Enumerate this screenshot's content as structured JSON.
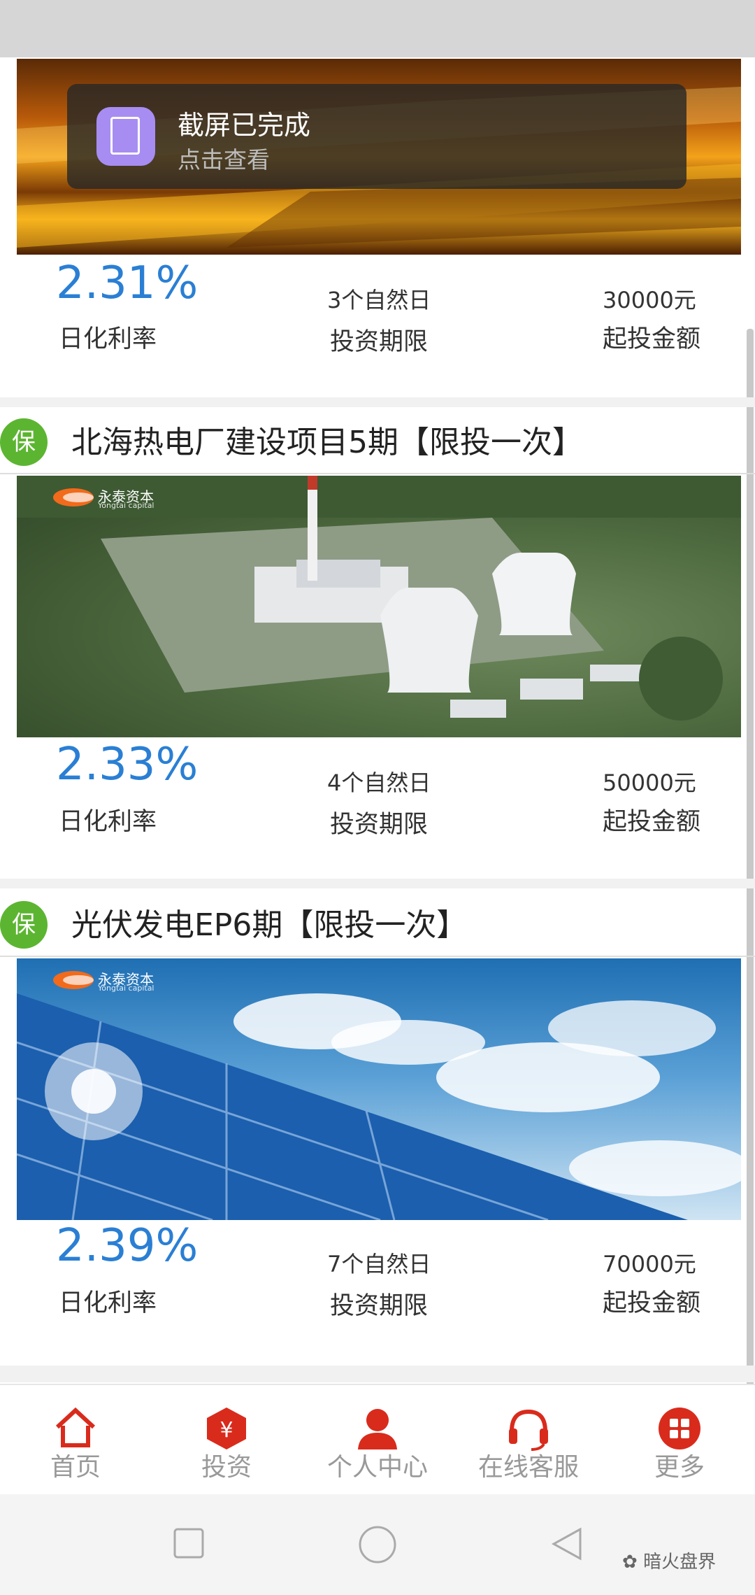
{
  "toast": {
    "title": "截屏已完成",
    "subtitle": "点击查看"
  },
  "banner_logo": {
    "text": "永泰资本",
    "sub": "Yongtai capital"
  },
  "products": [
    {
      "title": "",
      "rate": "2.31%",
      "rate_label": "日化利率",
      "term": "3个自然日",
      "term_label": "投资期限",
      "amount": "30000元",
      "amount_label": "起投金额"
    },
    {
      "badge": "保",
      "title": "北海热电厂建设项目5期【限投一次】",
      "rate": "2.33%",
      "rate_label": "日化利率",
      "term": "4个自然日",
      "term_label": "投资期限",
      "amount": "50000元",
      "amount_label": "起投金额"
    },
    {
      "badge": "保",
      "title": "光伏发电EP6期【限投一次】",
      "rate": "2.39%",
      "rate_label": "日化利率",
      "term": "7个自然日",
      "term_label": "投资期限",
      "amount": "70000元",
      "amount_label": "起投金额"
    }
  ],
  "nav": [
    {
      "label": "首页",
      "icon": "home-icon"
    },
    {
      "label": "投资",
      "icon": "yen-hexagon-icon"
    },
    {
      "label": "个人中心",
      "icon": "person-icon"
    },
    {
      "label": "在线客服",
      "icon": "headset-icon"
    },
    {
      "label": "更多",
      "icon": "grid-more-icon"
    }
  ],
  "watermark": "暗火盘界",
  "colors": {
    "accent_red": "#d92b1c",
    "rate_blue": "#2a7fd4",
    "badge_green": "#5cb531"
  }
}
